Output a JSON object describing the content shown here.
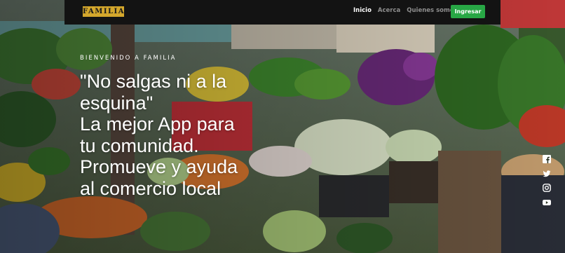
{
  "navbar": {
    "brand": "FAMILIA",
    "links": [
      {
        "label": "Inicio",
        "active": true
      },
      {
        "label": "Acerca",
        "active": false
      },
      {
        "label": "Quienes somos",
        "active": false
      }
    ],
    "cta_label": "Ingresar"
  },
  "hero": {
    "eyebrow": "BIENVENIDO A FAMILIA",
    "title_lines": [
      "\"No salgas ni a la",
      "esquina\"",
      "La mejor App para",
      "tu comunidad.",
      "Promueve y ayuda",
      "al comercio local"
    ]
  },
  "social": {
    "icons": [
      "facebook-icon",
      "twitter-icon",
      "instagram-icon",
      "youtube-icon"
    ]
  },
  "colors": {
    "navbar_bg": "#131313",
    "brand_gold": "#d4a72c",
    "cta_green": "#28a745",
    "nav_inactive": "#8d8d8d",
    "text_white": "#ffffff"
  }
}
